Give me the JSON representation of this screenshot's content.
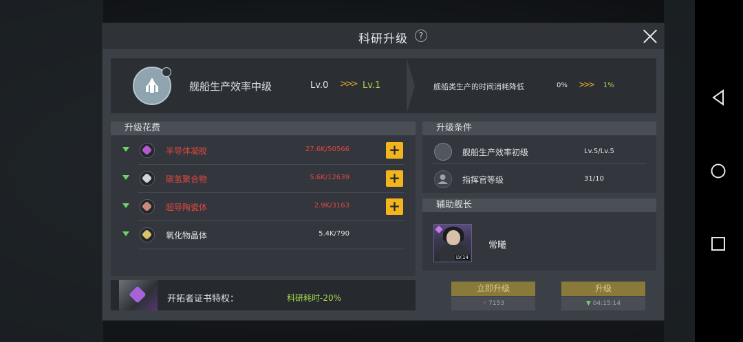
{
  "dialog": {
    "title": "科研升级",
    "help_glyph": "?"
  },
  "tech": {
    "name": "舰船生产效率中级",
    "level_from": "Lv.0",
    "level_to": "Lv.1",
    "arrows": ">>>",
    "effect_desc": "舰船类生产的时间消耗降低",
    "effect_from": "0%",
    "effect_to": "1%"
  },
  "cost": {
    "header": "升级花费",
    "items": [
      {
        "name": "半导体凝胶",
        "amount": "27.6K/50566",
        "insufficient": true,
        "gem_color": "#b35ad0"
      },
      {
        "name": "碳氢聚合物",
        "amount": "5.6K/12639",
        "insufficient": true,
        "gem_color": "#cfd5d8"
      },
      {
        "name": "超导陶瓷体",
        "amount": "2.9K/3163",
        "insufficient": true,
        "gem_color": "#c98a7a"
      },
      {
        "name": "氧化物晶体",
        "amount": "5.4K/790",
        "insufficient": false,
        "gem_color": "#d9c26a"
      }
    ],
    "plus_glyph": "+"
  },
  "perk": {
    "label": "开拓者证书特权：",
    "value": "科研耗时-20%"
  },
  "conditions": {
    "header": "升级条件",
    "items": [
      {
        "name": "舰船生产效率初级",
        "value": "Lv.5/Lv.5"
      },
      {
        "name": "指挥官等级",
        "value": "31/10"
      }
    ]
  },
  "assistant": {
    "header": "辅助舰长",
    "name": "常曦",
    "level_tag": "LV.14"
  },
  "buttons": {
    "instant_label": "立即升级",
    "instant_cost": "7153",
    "upgrade_label": "升级",
    "upgrade_time": "04:15:14"
  },
  "colors": {
    "accent_yellow": "#f2b51e",
    "insufficient_red": "#e0473f",
    "level_green": "#b6d04a"
  }
}
